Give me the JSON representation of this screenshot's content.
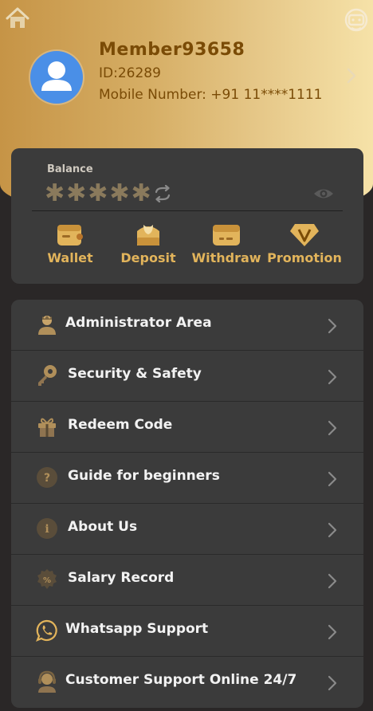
{
  "profile": {
    "username": "Member93658",
    "member_id": "ID:26289",
    "mobile": "Mobile Number: +91 11****1111"
  },
  "header": {
    "left_icon": "home-icon",
    "right_icon": "customer-support-icon"
  },
  "wallet": {
    "balance_label": "Balance",
    "balance_masked": "✱✱✱✱✱",
    "actions": [
      {
        "label": "Wallet",
        "icon": "wallet-icon"
      },
      {
        "label": "Deposit",
        "icon": "deposit-icon"
      },
      {
        "label": "Withdraw",
        "icon": "withdraw-icon"
      },
      {
        "label": "Promotion",
        "icon": "promotion-icon"
      }
    ]
  },
  "menu": {
    "items": [
      {
        "label": "Administrator Area",
        "icon": "admin-icon"
      },
      {
        "label": "Security & Safety",
        "icon": "key-icon"
      },
      {
        "label": "Redeem Code",
        "icon": "gift-icon"
      },
      {
        "label": "Guide for beginners",
        "icon": "question-icon"
      },
      {
        "label": "About Us",
        "icon": "info-icon"
      },
      {
        "label": "Salary Record",
        "icon": "percent-badge-icon"
      },
      {
        "label": "Whatsapp Support",
        "icon": "whatsapp-icon"
      },
      {
        "label": "Customer Support Online 24/7",
        "icon": "headset-icon"
      }
    ]
  },
  "colors": {
    "gold_gradient_start": "#c69446",
    "gold_gradient_end": "#f6e2a8",
    "accent_gold": "#e2b45b",
    "profile_text": "#7a4b06",
    "card_bg": "#3b3b3b",
    "page_bg": "#2a2727"
  }
}
